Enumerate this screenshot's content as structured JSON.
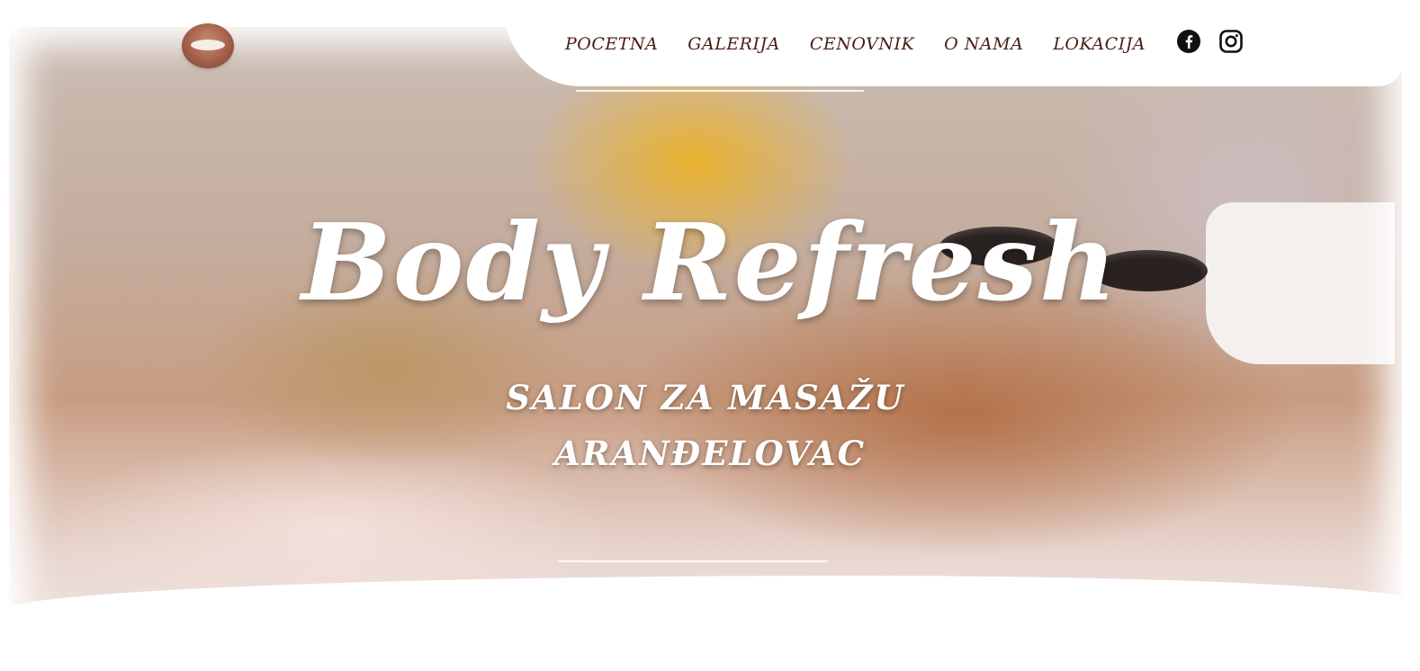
{
  "brand": {
    "logo_icon": "massage-logo-icon",
    "title": "Body Refresh",
    "subtitle_line1": "SALON ZA MASAŽU",
    "subtitle_line2": "ARANĐELOVAC"
  },
  "nav": {
    "items": [
      {
        "label": "POCETNA"
      },
      {
        "label": "GALERIJA"
      },
      {
        "label": "CENOVNIK"
      },
      {
        "label": "O NAMA"
      },
      {
        "label": "LOKACIJA"
      }
    ],
    "social": [
      {
        "icon": "facebook-icon"
      },
      {
        "icon": "instagram-icon"
      }
    ]
  },
  "colors": {
    "nav_text": "#4a1d16",
    "hero_text": "#ffffff",
    "accent_gold": "#ecb228",
    "logo_brown": "#a2604a"
  },
  "hero": {
    "image_description_icon": "massage-photo"
  }
}
